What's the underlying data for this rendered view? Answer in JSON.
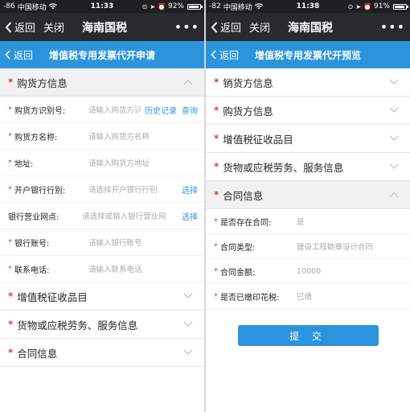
{
  "left": {
    "status": {
      "signal": "-86",
      "carrier": "中国移动",
      "time": "11:33",
      "battery": "92%",
      "battery_level": 0.92
    },
    "nav": {
      "back_label": "返回",
      "close_label": "关闭",
      "title": "海南国税",
      "more": "•••"
    },
    "sub": {
      "back_label": "返回",
      "title": "增值税专用发票代开申请"
    },
    "sections": {
      "buyer": "购货方信息",
      "items": "增值税征收品目",
      "goods": "货物或应税劳务、服务信息",
      "contract": "合同信息"
    },
    "fields": [
      {
        "label": "购货方识别号:",
        "placeholder": "请输入购货方识",
        "actions": [
          "历史记录",
          "查询"
        ],
        "required": true
      },
      {
        "label": "购货方名称:",
        "placeholder": "请输入购货方名称",
        "actions": [],
        "required": true
      },
      {
        "label": "地址:",
        "placeholder": "请输入购货方地址",
        "actions": [],
        "required": true
      },
      {
        "label": "开户银行行别:",
        "placeholder": "请选择开户银行行别",
        "actions": [
          "选择"
        ],
        "required": true
      },
      {
        "label": "银行营业网点:",
        "placeholder": "请选择或输入银行营业网",
        "actions": [
          "选择"
        ],
        "required": false
      },
      {
        "label": "银行账号:",
        "placeholder": "请输入银行账号",
        "actions": [],
        "required": true
      },
      {
        "label": "联系电话:",
        "placeholder": "请输入联系电话",
        "actions": [],
        "required": true
      }
    ]
  },
  "right": {
    "status": {
      "signal": "-82",
      "carrier": "中国移动",
      "time": "11:38",
      "battery": "91%",
      "battery_level": 0.91
    },
    "nav": {
      "back_label": "返回",
      "close_label": "关闭",
      "title": "海南国税",
      "more": "•••"
    },
    "sub": {
      "back_label": "返回",
      "title": "增值税专用发票代开预览"
    },
    "sections": {
      "seller": "销货方信息",
      "buyer": "购货方信息",
      "items": "增值税征收品目",
      "goods": "货物或应税劳务、服务信息",
      "contract": "合同信息"
    },
    "fields": [
      {
        "label": "是否存在合同:",
        "value": "是"
      },
      {
        "label": "合同类型:",
        "value": "建设工程勘察设计合同"
      },
      {
        "label": "合同金额:",
        "value": "10000"
      },
      {
        "label": "是否已缴印花税:",
        "value": "已缴"
      }
    ],
    "submit_label": "提 交"
  },
  "colors": {
    "accent": "#2c94dd",
    "required": "#e03c3c",
    "navbar": "#2a2a2e",
    "statusbar": "#1f1f22"
  }
}
